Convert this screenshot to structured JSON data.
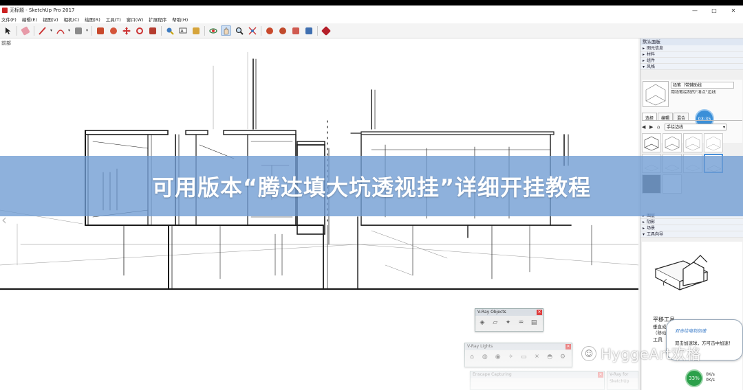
{
  "window": {
    "title": "无标题 - SketchUp Pro 2017",
    "buttons": [
      "—",
      "□",
      "✕"
    ]
  },
  "menu": [
    "文件(F)",
    "编辑(E)",
    "视图(V)",
    "相机(C)",
    "绘图(R)",
    "工具(T)",
    "窗口(W)",
    "扩展程序",
    "帮助(H)"
  ],
  "scene_label": "前部",
  "tray": {
    "title": "默认面板",
    "sections_top": [
      "图元信息",
      "材料",
      "组件"
    ],
    "styles_section": "风格",
    "style_name": "铅笔（带辅助线",
    "style_desc": "用铅笔绘制的\"消点\"边线",
    "time_badge": "03:35",
    "tabs": [
      "选择",
      "编辑",
      "混合"
    ],
    "library": "手绘边线",
    "sections_bottom": [
      "图层",
      "阴影",
      "场景",
      "工具向导"
    ],
    "tool_title": "平移工具",
    "tool_text": "垂直或水平平移（移动）相机。",
    "tool_text2": "工具"
  },
  "floats": {
    "vray_objects": "V-Ray Objects",
    "vray_lights": "V-Ray Lights",
    "enscape": "Enscape Capturing",
    "vray_sketchup": "V-Ray for SketchUp"
  },
  "banner": "可用版本“腾达填大坑透视挂”详细开挂教程",
  "watermark": "HyggeArt欢格",
  "bubble": {
    "line1": "双击绘电制加速",
    "line2": "双击加速球，方可击中加速！"
  },
  "status": {
    "percent": "33%",
    "info_line1": "0K/s",
    "info_line2": "0K/s"
  }
}
